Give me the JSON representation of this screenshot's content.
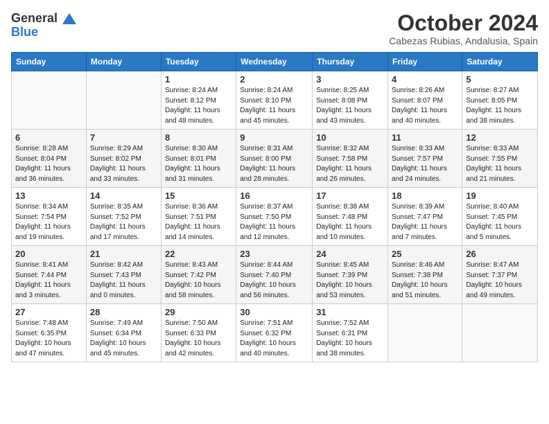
{
  "logo": {
    "line1": "General",
    "line2": "Blue"
  },
  "header": {
    "month": "October 2024",
    "location": "Cabezas Rubias, Andalusia, Spain"
  },
  "weekdays": [
    "Sunday",
    "Monday",
    "Tuesday",
    "Wednesday",
    "Thursday",
    "Friday",
    "Saturday"
  ],
  "weeks": [
    [
      {
        "day": "",
        "info": ""
      },
      {
        "day": "",
        "info": ""
      },
      {
        "day": "1",
        "info": "Sunrise: 8:24 AM\nSunset: 8:12 PM\nDaylight: 11 hours and 48 minutes."
      },
      {
        "day": "2",
        "info": "Sunrise: 8:24 AM\nSunset: 8:10 PM\nDaylight: 11 hours and 45 minutes."
      },
      {
        "day": "3",
        "info": "Sunrise: 8:25 AM\nSunset: 8:08 PM\nDaylight: 11 hours and 43 minutes."
      },
      {
        "day": "4",
        "info": "Sunrise: 8:26 AM\nSunset: 8:07 PM\nDaylight: 11 hours and 40 minutes."
      },
      {
        "day": "5",
        "info": "Sunrise: 8:27 AM\nSunset: 8:05 PM\nDaylight: 11 hours and 38 minutes."
      }
    ],
    [
      {
        "day": "6",
        "info": "Sunrise: 8:28 AM\nSunset: 8:04 PM\nDaylight: 11 hours and 36 minutes."
      },
      {
        "day": "7",
        "info": "Sunrise: 8:29 AM\nSunset: 8:02 PM\nDaylight: 11 hours and 33 minutes."
      },
      {
        "day": "8",
        "info": "Sunrise: 8:30 AM\nSunset: 8:01 PM\nDaylight: 11 hours and 31 minutes."
      },
      {
        "day": "9",
        "info": "Sunrise: 8:31 AM\nSunset: 8:00 PM\nDaylight: 11 hours and 28 minutes."
      },
      {
        "day": "10",
        "info": "Sunrise: 8:32 AM\nSunset: 7:58 PM\nDaylight: 11 hours and 26 minutes."
      },
      {
        "day": "11",
        "info": "Sunrise: 8:33 AM\nSunset: 7:57 PM\nDaylight: 11 hours and 24 minutes."
      },
      {
        "day": "12",
        "info": "Sunrise: 8:33 AM\nSunset: 7:55 PM\nDaylight: 11 hours and 21 minutes."
      }
    ],
    [
      {
        "day": "13",
        "info": "Sunrise: 8:34 AM\nSunset: 7:54 PM\nDaylight: 11 hours and 19 minutes."
      },
      {
        "day": "14",
        "info": "Sunrise: 8:35 AM\nSunset: 7:52 PM\nDaylight: 11 hours and 17 minutes."
      },
      {
        "day": "15",
        "info": "Sunrise: 8:36 AM\nSunset: 7:51 PM\nDaylight: 11 hours and 14 minutes."
      },
      {
        "day": "16",
        "info": "Sunrise: 8:37 AM\nSunset: 7:50 PM\nDaylight: 11 hours and 12 minutes."
      },
      {
        "day": "17",
        "info": "Sunrise: 8:38 AM\nSunset: 7:48 PM\nDaylight: 11 hours and 10 minutes."
      },
      {
        "day": "18",
        "info": "Sunrise: 8:39 AM\nSunset: 7:47 PM\nDaylight: 11 hours and 7 minutes."
      },
      {
        "day": "19",
        "info": "Sunrise: 8:40 AM\nSunset: 7:45 PM\nDaylight: 11 hours and 5 minutes."
      }
    ],
    [
      {
        "day": "20",
        "info": "Sunrise: 8:41 AM\nSunset: 7:44 PM\nDaylight: 11 hours and 3 minutes."
      },
      {
        "day": "21",
        "info": "Sunrise: 8:42 AM\nSunset: 7:43 PM\nDaylight: 11 hours and 0 minutes."
      },
      {
        "day": "22",
        "info": "Sunrise: 8:43 AM\nSunset: 7:42 PM\nDaylight: 10 hours and 58 minutes."
      },
      {
        "day": "23",
        "info": "Sunrise: 8:44 AM\nSunset: 7:40 PM\nDaylight: 10 hours and 56 minutes."
      },
      {
        "day": "24",
        "info": "Sunrise: 8:45 AM\nSunset: 7:39 PM\nDaylight: 10 hours and 53 minutes."
      },
      {
        "day": "25",
        "info": "Sunrise: 8:46 AM\nSunset: 7:38 PM\nDaylight: 10 hours and 51 minutes."
      },
      {
        "day": "26",
        "info": "Sunrise: 8:47 AM\nSunset: 7:37 PM\nDaylight: 10 hours and 49 minutes."
      }
    ],
    [
      {
        "day": "27",
        "info": "Sunrise: 7:48 AM\nSunset: 6:35 PM\nDaylight: 10 hours and 47 minutes."
      },
      {
        "day": "28",
        "info": "Sunrise: 7:49 AM\nSunset: 6:34 PM\nDaylight: 10 hours and 45 minutes."
      },
      {
        "day": "29",
        "info": "Sunrise: 7:50 AM\nSunset: 6:33 PM\nDaylight: 10 hours and 42 minutes."
      },
      {
        "day": "30",
        "info": "Sunrise: 7:51 AM\nSunset: 6:32 PM\nDaylight: 10 hours and 40 minutes."
      },
      {
        "day": "31",
        "info": "Sunrise: 7:52 AM\nSunset: 6:31 PM\nDaylight: 10 hours and 38 minutes."
      },
      {
        "day": "",
        "info": ""
      },
      {
        "day": "",
        "info": ""
      }
    ]
  ]
}
